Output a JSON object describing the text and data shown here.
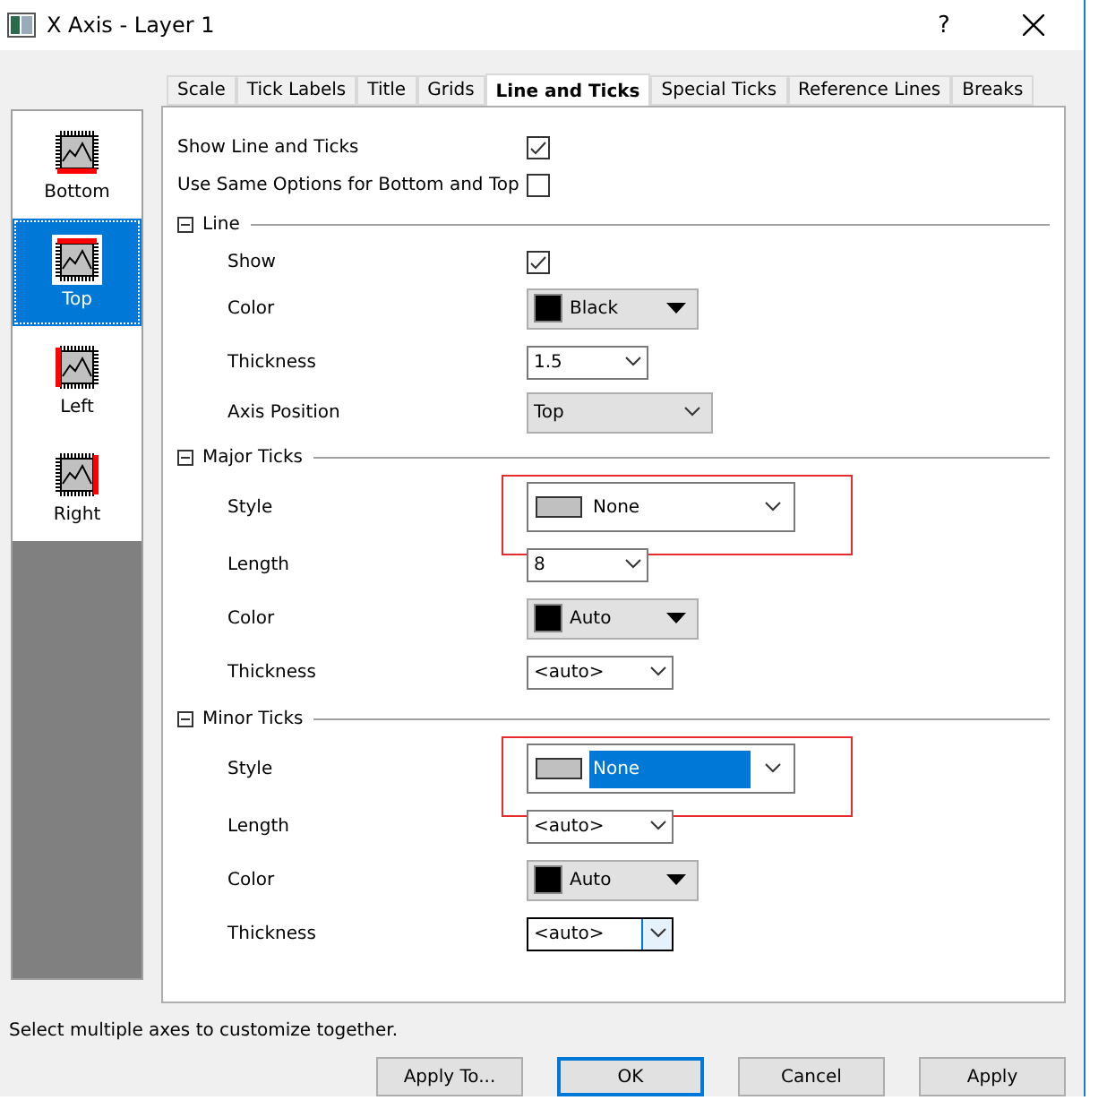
{
  "window": {
    "title": "X Axis - Layer 1",
    "help": "?"
  },
  "axes": [
    {
      "label": "Bottom",
      "kind": "bottom",
      "selected": false
    },
    {
      "label": "Top",
      "kind": "top",
      "selected": true
    },
    {
      "label": "Left",
      "kind": "left",
      "selected": false
    },
    {
      "label": "Right",
      "kind": "right",
      "selected": false
    }
  ],
  "tabs": [
    {
      "label": "Scale",
      "selected": false
    },
    {
      "label": "Tick Labels",
      "selected": false
    },
    {
      "label": "Title",
      "selected": false
    },
    {
      "label": "Grids",
      "selected": false
    },
    {
      "label": "Line and Ticks",
      "selected": true
    },
    {
      "label": "Special Ticks",
      "selected": false
    },
    {
      "label": "Reference Lines",
      "selected": false
    },
    {
      "label": "Breaks",
      "selected": false
    }
  ],
  "rows": [
    {
      "kind": "checkbox",
      "label": "Show Line and Ticks",
      "checked": true,
      "indent": false
    },
    {
      "kind": "checkbox",
      "label": "Use Same Options for Bottom and Top",
      "checked": false,
      "indent": false
    },
    {
      "kind": "section",
      "label": "Line",
      "expanded": true
    },
    {
      "kind": "checkbox",
      "label": "Show",
      "checked": true,
      "indent": true
    },
    {
      "kind": "color",
      "label": "Color",
      "value": "Black"
    },
    {
      "kind": "combo",
      "label": "Thickness",
      "value": "1.5"
    },
    {
      "kind": "dropdown",
      "label": "Axis Position",
      "value": "Top"
    },
    {
      "kind": "section",
      "label": "Major Ticks",
      "expanded": true
    },
    {
      "kind": "style",
      "label": "Style",
      "value": "None",
      "highlighted": true,
      "selected": false
    },
    {
      "kind": "combo",
      "label": "Length",
      "value": "8"
    },
    {
      "kind": "color",
      "label": "Color",
      "value": "Auto"
    },
    {
      "kind": "combo",
      "label": "Thickness",
      "value": "<auto>"
    },
    {
      "kind": "section",
      "label": "Minor Ticks",
      "expanded": true
    },
    {
      "kind": "style",
      "label": "Style",
      "value": "None",
      "highlighted": true,
      "selected": true
    },
    {
      "kind": "combo",
      "label": "Length",
      "value": "<auto>"
    },
    {
      "kind": "color",
      "label": "Color",
      "value": "Auto"
    },
    {
      "kind": "combo",
      "label": "Thickness",
      "value": "<auto>",
      "focused": true
    }
  ],
  "status": "Select multiple axes to customize together.",
  "buttons": [
    {
      "label": "Apply To...",
      "default": false
    },
    {
      "label": "OK",
      "default": true
    },
    {
      "label": "Cancel",
      "default": false
    },
    {
      "label": "Apply",
      "default": false
    }
  ]
}
